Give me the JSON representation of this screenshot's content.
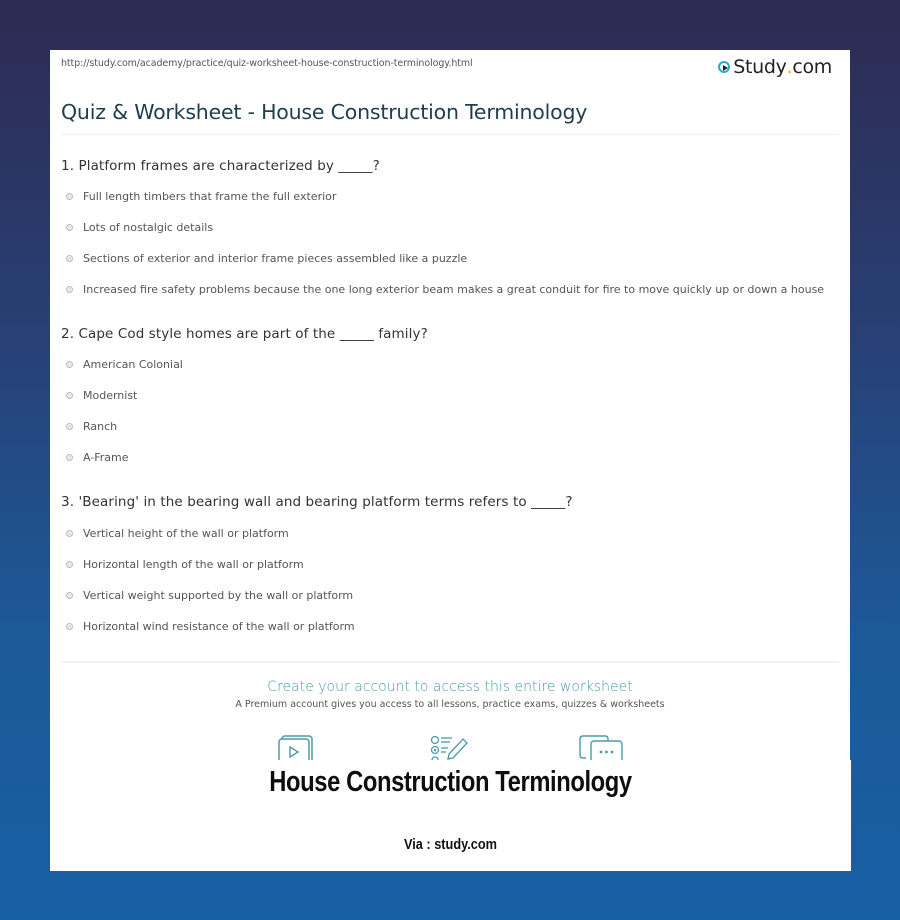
{
  "page": {
    "url": "http://study.com/academy/practice/quiz-worksheet-house-construction-terminology.html",
    "logo": {
      "name": "Study",
      "dot": ".",
      "suffix": "com"
    },
    "title": "Quiz & Worksheet - House Construction Terminology"
  },
  "questions": [
    {
      "text": "1. Platform frames are characterized by _____?",
      "options": [
        "Full length timbers that frame the full exterior",
        "Lots of nostalgic details",
        "Sections of exterior and interior frame pieces assembled like a puzzle",
        "Increased fire safety problems because the one long exterior beam makes a great conduit for fire to move quickly up or down a house"
      ]
    },
    {
      "text": "2. Cape Cod style homes are part of the _____ family?",
      "options": [
        "American Colonial",
        "Modernist",
        "Ranch",
        "A-Frame"
      ]
    },
    {
      "text": "3. 'Bearing' in the bearing wall and bearing platform terms refers to _____?",
      "options": [
        "Vertical height of the wall or platform",
        "Horizontal length of the wall or platform",
        "Vertical weight supported by the wall or platform",
        "Horizontal wind resistance of the wall or platform"
      ]
    }
  ],
  "cta": {
    "title": "Create your account to access this entire worksheet",
    "subtitle": "A Premium account gives you access to all lessons, practice exams, quizzes & worksheets",
    "icons": [
      "video-lesson-icon",
      "quiz-checklist-icon",
      "chat-support-icon"
    ],
    "accent": "#4c9aa8"
  },
  "caption": {
    "title": "House Construction Terminology",
    "via": "Via : study.com"
  }
}
